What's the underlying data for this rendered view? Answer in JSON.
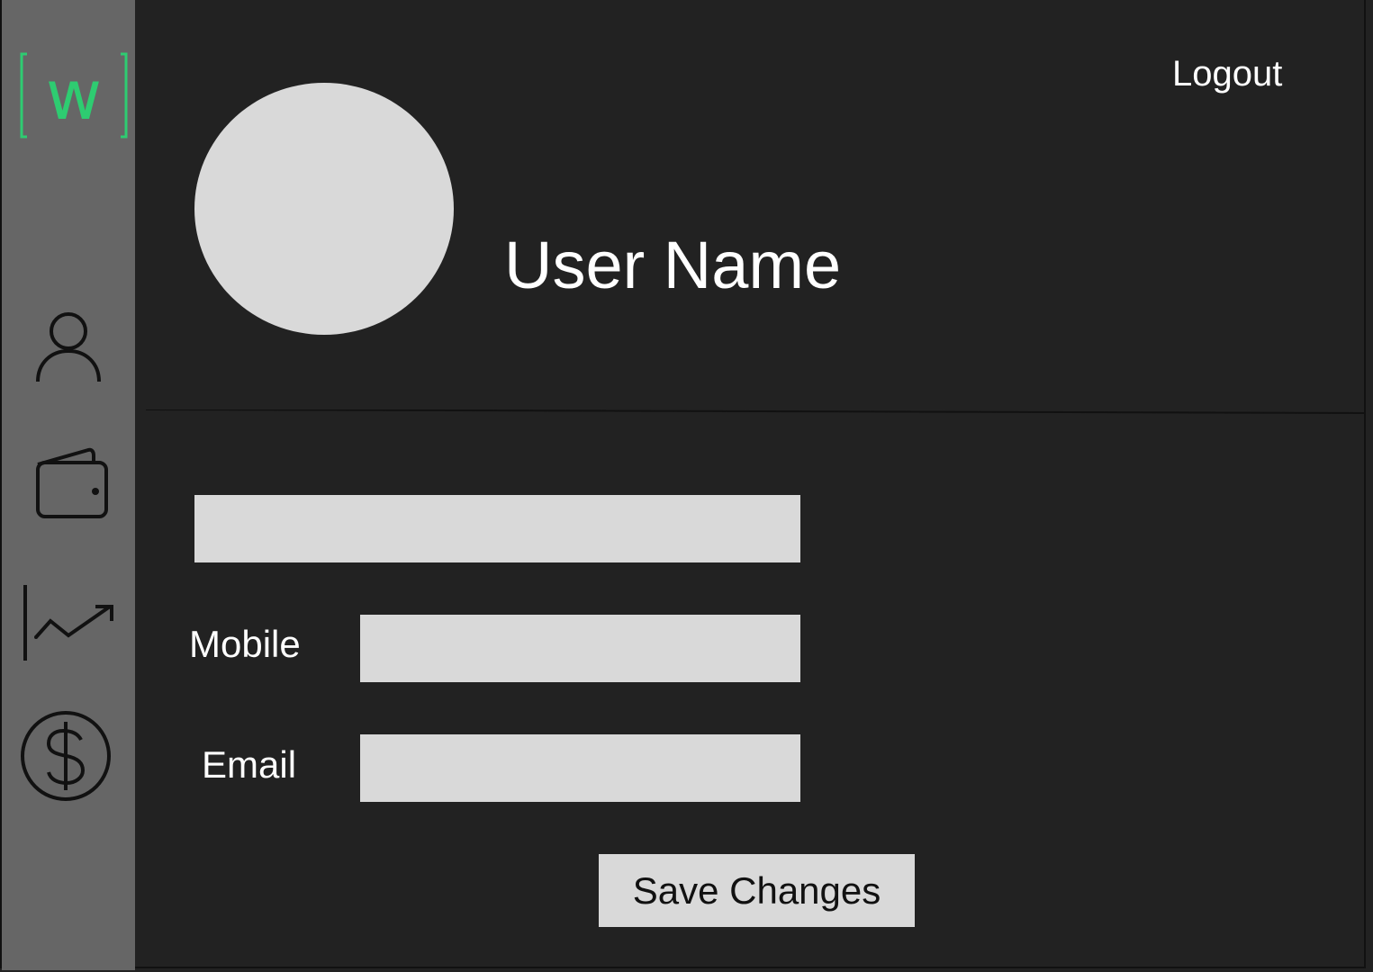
{
  "app": {
    "logo_letter": "w",
    "accent_color": "#2ecc71"
  },
  "sidebar": {
    "items": [
      {
        "icon": "user-icon"
      },
      {
        "icon": "wallet-icon"
      },
      {
        "icon": "chart-trend-icon"
      },
      {
        "icon": "dollar-circle-icon"
      }
    ]
  },
  "header": {
    "logout_label": "Logout",
    "user_name": "User Name"
  },
  "form": {
    "name_value": "",
    "mobile_label": "Mobile",
    "mobile_value": "",
    "email_label": "Email",
    "email_value": "",
    "save_label": "Save Changes"
  }
}
